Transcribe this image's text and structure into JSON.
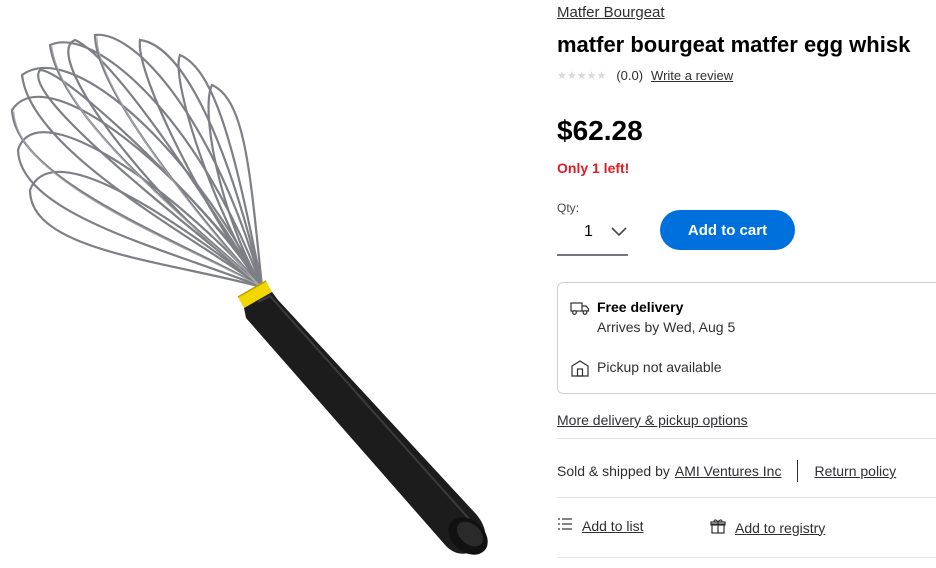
{
  "product": {
    "brand": "Matfer Bourgeat",
    "title": "matfer bourgeat matfer egg whisk",
    "rating_stars": "★★★★★",
    "rating_count": "(0.0)",
    "write_review": "Write a review",
    "price": "$62.28",
    "stock_note": "Only 1 left!",
    "image_alt": "egg whisk with black handle"
  },
  "purchase": {
    "qty_label": "Qty:",
    "qty_value": "1",
    "add_to_cart": "Add to cart"
  },
  "fulfillment": {
    "delivery_title": "Free delivery",
    "delivery_date": "Arrives by Wed, Aug 5",
    "pickup": "Pickup not available",
    "more_options": "More delivery & pickup options"
  },
  "seller": {
    "sold_by_label": "Sold & shipped by",
    "seller_name": "AMI Ventures Inc",
    "return_policy": "Return policy"
  },
  "actions": {
    "add_to_list": "Add to list",
    "add_to_registry": "Add to registry"
  },
  "icons": {
    "truck": "truck-icon",
    "store": "store-icon",
    "list": "list-icon",
    "gift": "gift-icon",
    "chevron": "chevron-down-icon"
  },
  "colors": {
    "accent": "#0071dc",
    "stock_red": "#de1c24",
    "text": "#2e2f32"
  }
}
